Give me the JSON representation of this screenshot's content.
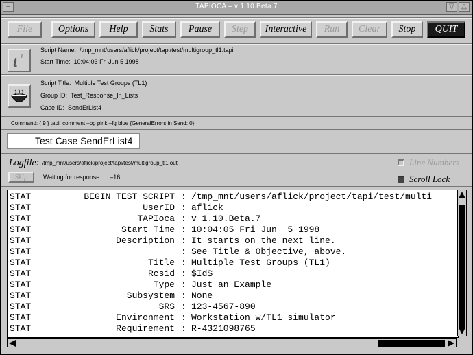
{
  "window": {
    "title": "TAPIOCA – v 1.10.Beta.7"
  },
  "menubar": {
    "buttons": [
      {
        "label": "File",
        "enabled": false
      },
      {
        "label": "Options",
        "enabled": true
      },
      {
        "label": "Help",
        "enabled": true
      },
      {
        "label": "Stats",
        "enabled": true
      },
      {
        "label": "Pause",
        "enabled": true
      },
      {
        "label": "Step",
        "enabled": false
      },
      {
        "label": "Interactive",
        "enabled": true
      },
      {
        "label": "Run",
        "enabled": false
      },
      {
        "label": "Clear",
        "enabled": false
      },
      {
        "label": "Stop",
        "enabled": true
      },
      {
        "label": "QUIT",
        "enabled": true
      }
    ]
  },
  "script_info": {
    "name_label": "Script Name:",
    "name_value": "/tmp_mnt/users/aflick/project/tapi/test/multigroup_tl1.tapi",
    "start_label": "Start Time:",
    "start_value": "10:04:03 Fri Jun  5 1998",
    "title_label": "Script Title:",
    "title_value": "Multiple Test Groups (TL1)",
    "group_label": "Group ID:",
    "group_value": "Test_Response_In_Lists",
    "case_label": "Case ID:",
    "case_value": "SendErList4"
  },
  "command_line": "Command: {   9 }    tapi_comment –bg pink –fg blue {GeneralErrors in Send: 0}",
  "test_case": "Test Case SendErList4",
  "logfile": {
    "label": "Logfile:",
    "path": "/tmp_mnt/users/aflick/project/tapi/test/multigroup_tl1.out",
    "skip_label": "Skip",
    "waiting": "Waiting for response ....   –16",
    "line_numbers_label": "Line Numbers",
    "line_numbers_checked": false,
    "scroll_lock_label": "Scroll Lock",
    "scroll_lock_checked": true
  },
  "output": [
    {
      "tag": "STAT",
      "key": "BEGIN TEST SCRIPT",
      "sep": ":",
      "value": "/tmp_mnt/users/aflick/project/tapi/test/multi"
    },
    {
      "tag": "STAT",
      "key": "UserID",
      "sep": ":",
      "value": "aflick"
    },
    {
      "tag": "STAT",
      "key": "TAPIoca",
      "sep": ":",
      "value": "v 1.10.Beta.7"
    },
    {
      "tag": "STAT",
      "key": "Start Time",
      "sep": ":",
      "value": "10:04:05 Fri Jun  5 1998"
    },
    {
      "tag": "STAT",
      "key": "Description",
      "sep": ":",
      "value": "It starts on the next line."
    },
    {
      "tag": "STAT",
      "key": "",
      "sep": ":",
      "value": "See Title & Objective, above."
    },
    {
      "tag": "STAT",
      "key": "Title",
      "sep": ":",
      "value": "Multiple Test Groups (TL1)"
    },
    {
      "tag": "STAT",
      "key": "Rcsid",
      "sep": ":",
      "value": "$Id$"
    },
    {
      "tag": "STAT",
      "key": "Type",
      "sep": ":",
      "value": "Just an Example"
    },
    {
      "tag": "STAT",
      "key": "Subsystem",
      "sep": ":",
      "value": "None"
    },
    {
      "tag": "STAT",
      "key": "SRS",
      "sep": ":",
      "value": "123-4567-890"
    },
    {
      "tag": "STAT",
      "key": "Environment",
      "sep": ":",
      "value": "Workstation w/TL1_simulator"
    },
    {
      "tag": "STAT",
      "key": "Requirement",
      "sep": ":",
      "value": "R-4321098765"
    }
  ]
}
